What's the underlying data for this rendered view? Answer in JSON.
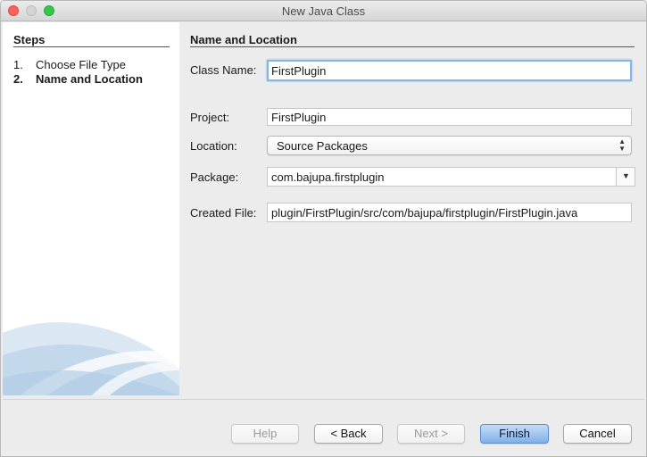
{
  "window": {
    "title": "New Java Class"
  },
  "steps": {
    "title": "Steps",
    "items": [
      {
        "num": "1.",
        "label": "Choose File Type"
      },
      {
        "num": "2.",
        "label": "Name and Location"
      }
    ]
  },
  "panel": {
    "title": "Name and Location",
    "class_name": {
      "label": "Class Name:",
      "value": "FirstPlugin"
    },
    "project": {
      "label": "Project:",
      "value": "FirstPlugin"
    },
    "location": {
      "label": "Location:",
      "value": "Source Packages"
    },
    "package": {
      "label": "Package:",
      "value": "com.bajupa.firstplugin"
    },
    "created_file": {
      "label": "Created File:",
      "value": "plugin/FirstPlugin/src/com/bajupa/firstplugin/FirstPlugin.java"
    }
  },
  "buttons": {
    "help": "Help",
    "back": "< Back",
    "next": "Next >",
    "finish": "Finish",
    "cancel": "Cancel"
  },
  "colors": {
    "default_button": "#7fb0ea",
    "focus_ring": "#86b3e8"
  }
}
